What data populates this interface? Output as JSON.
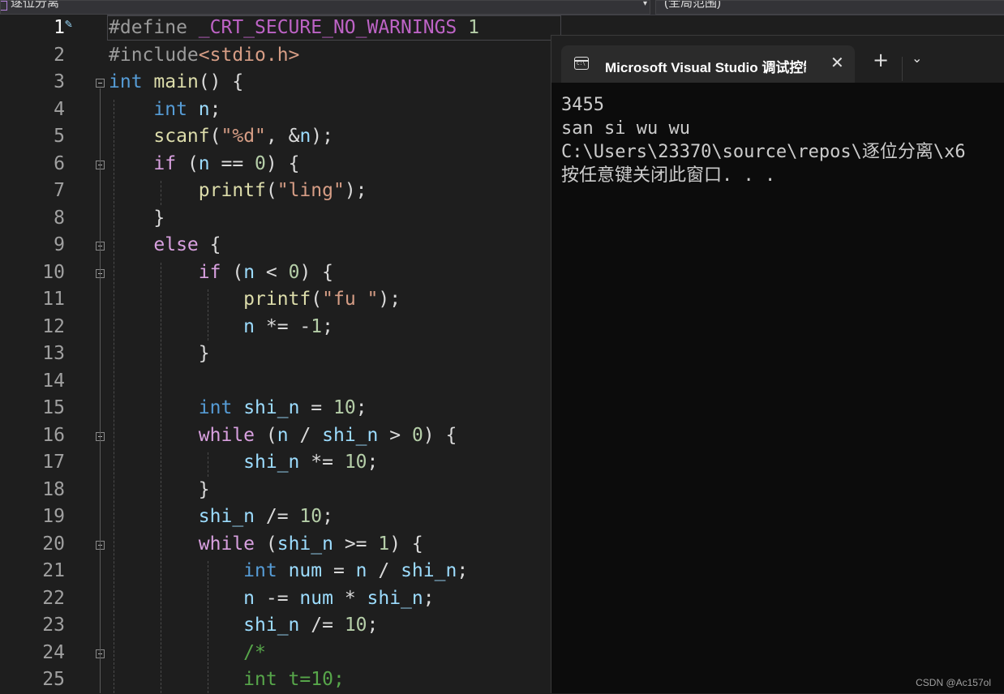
{
  "toolbar": {
    "project_name": "逐位分离",
    "scope": "(全局范围)"
  },
  "editor": {
    "lines": [
      {
        "n": "1",
        "t": [
          [
            "p",
            "#define "
          ],
          [
            "m",
            "_CRT_SECURE_NO_WARNINGS"
          ],
          [
            "t",
            " "
          ],
          [
            "n",
            "1"
          ]
        ]
      },
      {
        "n": "2",
        "t": [
          [
            "p",
            "#include"
          ],
          [
            "s",
            "<stdio.h>"
          ]
        ]
      },
      {
        "n": "3",
        "t": [
          [
            "k",
            "int"
          ],
          [
            "t",
            " "
          ],
          [
            "f",
            "main"
          ],
          [
            "t",
            "() {"
          ]
        ]
      },
      {
        "n": "4",
        "t": [
          [
            "t",
            "    "
          ],
          [
            "k",
            "int"
          ],
          [
            "t",
            " "
          ],
          [
            "v",
            "n"
          ],
          [
            "t",
            ";"
          ]
        ]
      },
      {
        "n": "5",
        "t": [
          [
            "t",
            "    "
          ],
          [
            "f",
            "scanf"
          ],
          [
            "t",
            "("
          ],
          [
            "s",
            "\"%d\""
          ],
          [
            "t",
            ", &"
          ],
          [
            "v",
            "n"
          ],
          [
            "t",
            ");"
          ]
        ]
      },
      {
        "n": "6",
        "t": [
          [
            "t",
            "    "
          ],
          [
            "c",
            "if"
          ],
          [
            "t",
            " ("
          ],
          [
            "v",
            "n"
          ],
          [
            "t",
            " == "
          ],
          [
            "n",
            "0"
          ],
          [
            "t",
            ") {"
          ]
        ]
      },
      {
        "n": "7",
        "t": [
          [
            "t",
            "        "
          ],
          [
            "f",
            "printf"
          ],
          [
            "t",
            "("
          ],
          [
            "s",
            "\"ling\""
          ],
          [
            "t",
            ");"
          ]
        ]
      },
      {
        "n": "8",
        "t": [
          [
            "t",
            "    }"
          ]
        ]
      },
      {
        "n": "9",
        "t": [
          [
            "t",
            "    "
          ],
          [
            "c",
            "else"
          ],
          [
            "t",
            " {"
          ]
        ]
      },
      {
        "n": "10",
        "t": [
          [
            "t",
            "        "
          ],
          [
            "c",
            "if"
          ],
          [
            "t",
            " ("
          ],
          [
            "v",
            "n"
          ],
          [
            "t",
            " < "
          ],
          [
            "n",
            "0"
          ],
          [
            "t",
            ") {"
          ]
        ]
      },
      {
        "n": "11",
        "t": [
          [
            "t",
            "            "
          ],
          [
            "f",
            "printf"
          ],
          [
            "t",
            "("
          ],
          [
            "s",
            "\"fu \""
          ],
          [
            "t",
            ");"
          ]
        ]
      },
      {
        "n": "12",
        "t": [
          [
            "t",
            "            "
          ],
          [
            "v",
            "n"
          ],
          [
            "t",
            " *= -"
          ],
          [
            "n",
            "1"
          ],
          [
            "t",
            ";"
          ]
        ]
      },
      {
        "n": "13",
        "t": [
          [
            "t",
            "        }"
          ]
        ]
      },
      {
        "n": "14",
        "t": []
      },
      {
        "n": "15",
        "t": [
          [
            "t",
            "        "
          ],
          [
            "k",
            "int"
          ],
          [
            "t",
            " "
          ],
          [
            "v",
            "shi_n"
          ],
          [
            "t",
            " = "
          ],
          [
            "n",
            "10"
          ],
          [
            "t",
            ";"
          ]
        ]
      },
      {
        "n": "16",
        "t": [
          [
            "t",
            "        "
          ],
          [
            "c",
            "while"
          ],
          [
            "t",
            " ("
          ],
          [
            "v",
            "n"
          ],
          [
            "t",
            " / "
          ],
          [
            "v",
            "shi_n"
          ],
          [
            "t",
            " > "
          ],
          [
            "n",
            "0"
          ],
          [
            "t",
            ") {"
          ]
        ]
      },
      {
        "n": "17",
        "t": [
          [
            "t",
            "            "
          ],
          [
            "v",
            "shi_n"
          ],
          [
            "t",
            " *= "
          ],
          [
            "n",
            "10"
          ],
          [
            "t",
            ";"
          ]
        ]
      },
      {
        "n": "18",
        "t": [
          [
            "t",
            "        }"
          ]
        ]
      },
      {
        "n": "19",
        "t": [
          [
            "t",
            "        "
          ],
          [
            "v",
            "shi_n"
          ],
          [
            "t",
            " /= "
          ],
          [
            "n",
            "10"
          ],
          [
            "t",
            ";"
          ]
        ]
      },
      {
        "n": "20",
        "t": [
          [
            "t",
            "        "
          ],
          [
            "c",
            "while"
          ],
          [
            "t",
            " ("
          ],
          [
            "v",
            "shi_n"
          ],
          [
            "t",
            " >= "
          ],
          [
            "n",
            "1"
          ],
          [
            "t",
            ") {"
          ]
        ]
      },
      {
        "n": "21",
        "t": [
          [
            "t",
            "            "
          ],
          [
            "k",
            "int"
          ],
          [
            "t",
            " "
          ],
          [
            "v",
            "num"
          ],
          [
            "t",
            " = "
          ],
          [
            "v",
            "n"
          ],
          [
            "t",
            " / "
          ],
          [
            "v",
            "shi_n"
          ],
          [
            "t",
            ";"
          ]
        ]
      },
      {
        "n": "22",
        "t": [
          [
            "t",
            "            "
          ],
          [
            "v",
            "n"
          ],
          [
            "t",
            " -= "
          ],
          [
            "v",
            "num"
          ],
          [
            "t",
            " * "
          ],
          [
            "v",
            "shi_n"
          ],
          [
            "t",
            ";"
          ]
        ]
      },
      {
        "n": "23",
        "t": [
          [
            "t",
            "            "
          ],
          [
            "v",
            "shi_n"
          ],
          [
            "t",
            " /= "
          ],
          [
            "n",
            "10"
          ],
          [
            "t",
            ";"
          ]
        ]
      },
      {
        "n": "24",
        "t": [
          [
            "t",
            "            "
          ],
          [
            "g",
            "/*"
          ]
        ]
      },
      {
        "n": "25",
        "t": [
          [
            "t",
            "            "
          ],
          [
            "g",
            "int t=10;"
          ]
        ]
      }
    ]
  },
  "console": {
    "tab_title": "Microsoft Visual Studio 调试控制台",
    "new_tab_label": "+",
    "output_lines": [
      "3455",
      "san si wu wu",
      "C:\\Users\\23370\\source\\repos\\逐位分离\\x6",
      "按任意键关闭此窗口. . ."
    ]
  },
  "watermark": "CSDN @Ac157ol"
}
